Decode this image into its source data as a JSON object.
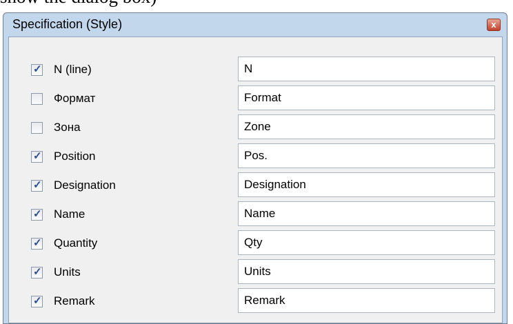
{
  "caption": "show the dialog box)",
  "window": {
    "title": "Specification (Style)",
    "close_symbol": "x",
    "close_icon": "close-icon"
  },
  "rows": [
    {
      "label": "N (line)",
      "checked": true,
      "value": "N"
    },
    {
      "label": "Формат",
      "checked": false,
      "value": "Format"
    },
    {
      "label": "Зона",
      "checked": false,
      "value": "Zone"
    },
    {
      "label": "Position",
      "checked": true,
      "value": "Pos."
    },
    {
      "label": "Designation",
      "checked": true,
      "value": "Designation"
    },
    {
      "label": "Name",
      "checked": true,
      "value": "Name"
    },
    {
      "label": "Quantity",
      "checked": true,
      "value": "Qty"
    },
    {
      "label": "Units",
      "checked": true,
      "value": "Units"
    },
    {
      "label": "Remark",
      "checked": true,
      "value": "Remark"
    }
  ]
}
